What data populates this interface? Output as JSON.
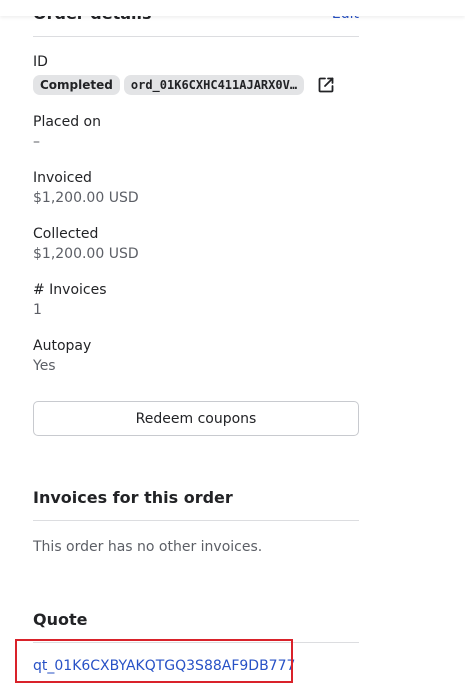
{
  "order_details": {
    "title": "Order details",
    "edit_label": "Edit"
  },
  "fields": {
    "id_label": "ID",
    "status_badge": "Completed",
    "order_id": "ord_01K6CXHC411AJARX0V…",
    "placed_on_label": "Placed on",
    "placed_on_value": "–",
    "invoiced_label": "Invoiced",
    "invoiced_value": "$1,200.00 USD",
    "collected_label": "Collected",
    "collected_value": "$1,200.00 USD",
    "invoices_count_label": "# Invoices",
    "invoices_count_value": "1",
    "autopay_label": "Autopay",
    "autopay_value": "Yes"
  },
  "actions": {
    "redeem_label": "Redeem coupons"
  },
  "invoices_section": {
    "title": "Invoices for this order",
    "empty_text": "This order has no other invoices."
  },
  "quote_section": {
    "title": "Quote",
    "quote_id": "qt_01K6CXBYAKQTGQ3S88AF9DB777"
  },
  "icons": {
    "external_link": "external-link-icon"
  },
  "colors": {
    "link": "#2751c6",
    "highlight": "#d9222a",
    "badge_bg": "#e3e4e6"
  }
}
